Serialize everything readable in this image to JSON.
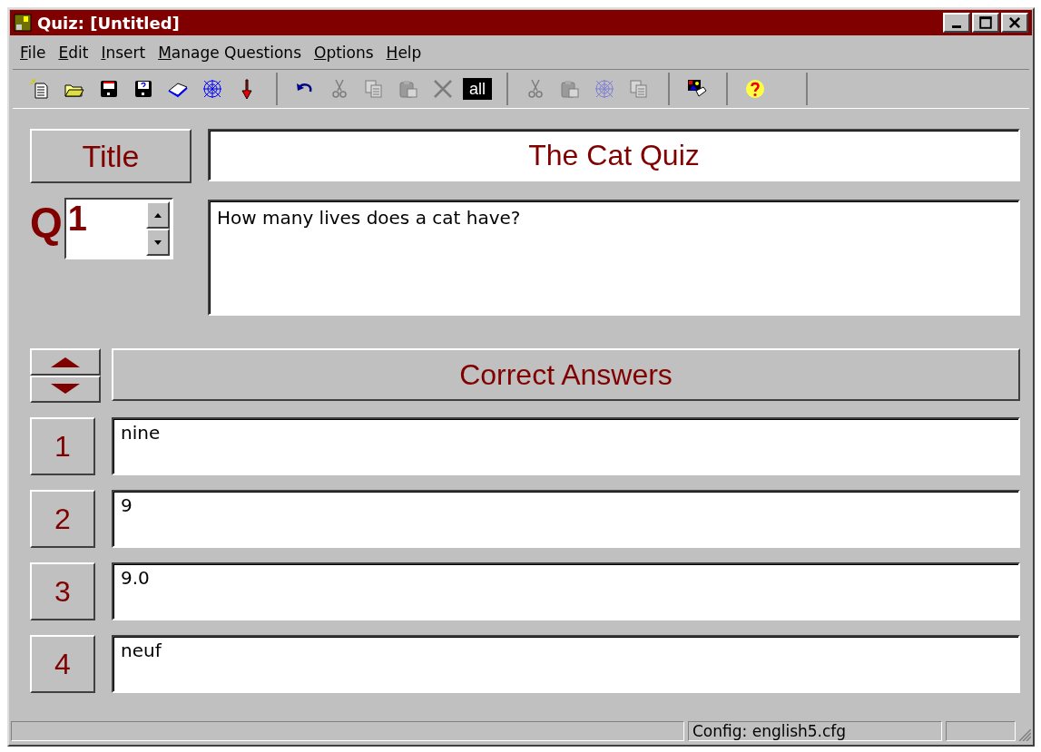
{
  "window": {
    "title": "Quiz: [Untitled]"
  },
  "menu": [
    {
      "label": "File"
    },
    {
      "label": "Edit"
    },
    {
      "label": "Insert"
    },
    {
      "label": "Manage Questions"
    },
    {
      "label": "Options"
    },
    {
      "label": "Help"
    }
  ],
  "toolbar": [
    [
      {
        "kind": "new",
        "disabled": false
      },
      {
        "kind": "open",
        "disabled": false
      },
      {
        "kind": "save",
        "disabled": false
      },
      {
        "kind": "saveas",
        "disabled": false
      },
      {
        "kind": "book",
        "disabled": false
      },
      {
        "kind": "web",
        "disabled": false
      },
      {
        "kind": "down",
        "disabled": false
      }
    ],
    [
      {
        "kind": "undo",
        "disabled": false
      },
      {
        "kind": "cut",
        "disabled": true
      },
      {
        "kind": "copy",
        "disabled": true
      },
      {
        "kind": "paste",
        "disabled": true
      },
      {
        "kind": "delete",
        "disabled": true
      },
      {
        "kind": "text",
        "label": "all",
        "disabled": false
      }
    ],
    [
      {
        "kind": "cut",
        "disabled": true
      },
      {
        "kind": "paste",
        "disabled": true
      },
      {
        "kind": "web",
        "disabled": true
      },
      {
        "kind": "copy",
        "disabled": true
      }
    ],
    [
      {
        "kind": "picture",
        "disabled": false
      }
    ],
    [
      {
        "kind": "help",
        "disabled": false
      }
    ]
  ],
  "title_label": "Title",
  "title_value": "The Cat Quiz",
  "question_label": "Q",
  "question_number": "1",
  "question_text": "How many lives does a cat have?",
  "answers_header": "Correct Answers",
  "answers": [
    {
      "number": "1",
      "value": "nine"
    },
    {
      "number": "2",
      "value": "9"
    },
    {
      "number": "3",
      "value": "9.0"
    },
    {
      "number": "4",
      "value": "neuf"
    }
  ],
  "status_bar": {
    "config": "Config: english5.cfg"
  }
}
